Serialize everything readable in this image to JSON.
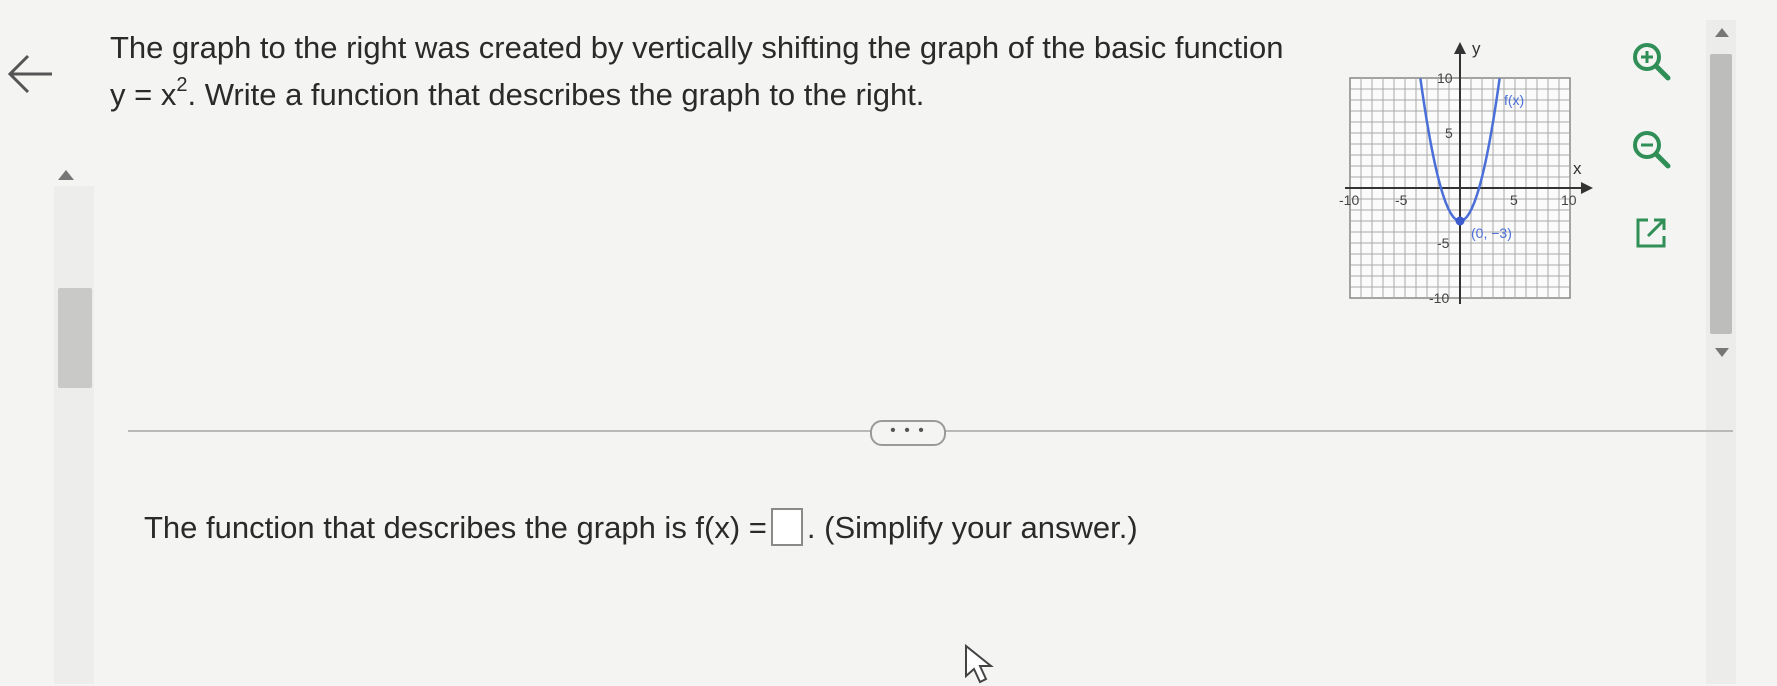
{
  "question": {
    "line1": "The graph to the right was created by vertically shifting the graph of the basic function",
    "line2_prefix": "y = x",
    "line2_exponent": "2",
    "line2_suffix": ". Write a function that describes the graph to the right."
  },
  "graph": {
    "y_axis_label": "y",
    "x_axis_label": "x",
    "curve_label": "f(x)",
    "vertex_label": "(0, −3)",
    "tick_labels": {
      "x_neg10": "-10",
      "x_neg5": "-5",
      "x_5": "5",
      "x_10": "10",
      "y_10": "10",
      "y_5": "5",
      "y_neg5": "-5",
      "y_neg10": "-10"
    },
    "curve_color": "#4a6fd8"
  },
  "toolbar": {
    "zoom_in_icon": "zoom-in-icon",
    "zoom_out_icon": "zoom-out-icon",
    "popout_icon": "external-link-icon",
    "accent_color": "#2f8f57"
  },
  "divider": {
    "more_label": "• • •"
  },
  "answer": {
    "prefix": "The function that describes the graph is f(x) =",
    "suffix": ". (Simplify your answer.)",
    "value": ""
  }
}
